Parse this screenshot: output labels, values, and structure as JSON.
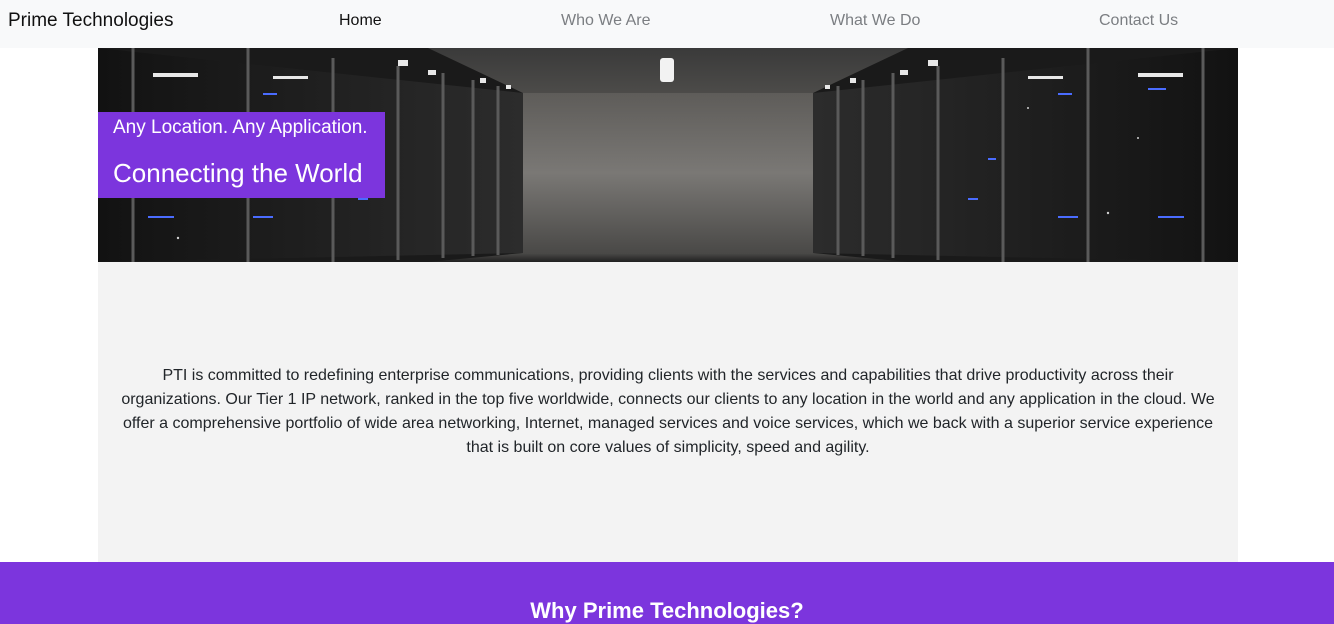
{
  "navbar": {
    "brand": "Prime Technologies",
    "links": [
      {
        "label": "Home",
        "active": true
      },
      {
        "label": "Who We Are",
        "active": false
      },
      {
        "label": "What We Do",
        "active": false
      },
      {
        "label": "Contact Us",
        "active": false
      }
    ]
  },
  "hero": {
    "tagline": "Any Location. Any Application.",
    "title": "Connecting the World"
  },
  "about": {
    "text": "PTI is committed to redefining enterprise communications, providing clients with the services and capabilities that drive productivity across their organizations. Our Tier 1 IP network, ranked in the top five worldwide, connects our clients to any location in the world and any application in the cloud. We offer a comprehensive portfolio of wide area networking, Internet, managed services and voice services, which we back with a superior service experience that is built on core values of simplicity, speed and agility."
  },
  "why": {
    "heading": "Why Prime Technologies?"
  },
  "colors": {
    "accent": "#7c35dd",
    "navbar_bg": "#f8f9fa",
    "section_bg": "#f3f3f3"
  }
}
